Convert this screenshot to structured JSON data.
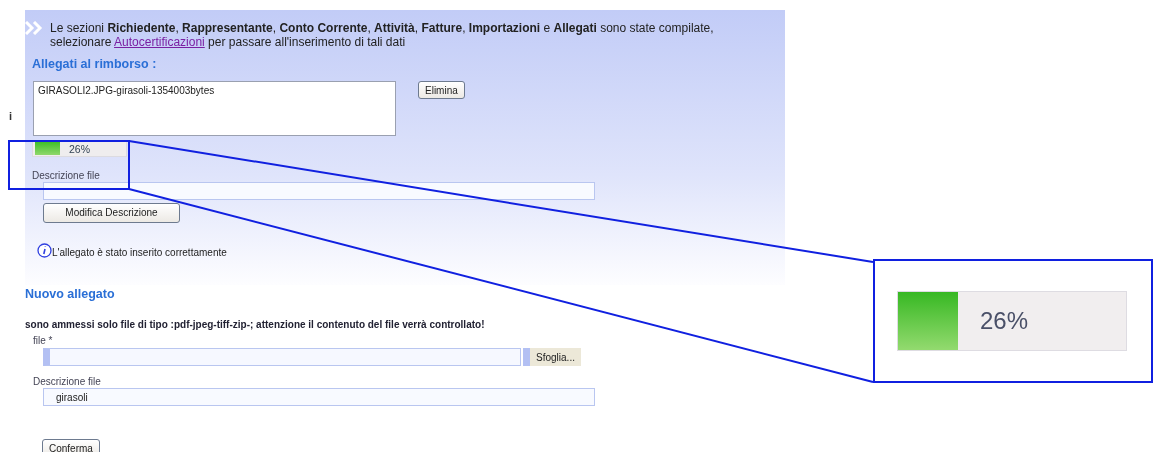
{
  "stray_mark": "i",
  "notice": {
    "before": "Le sezioni **Richiedente**, **Rappresentante**, **Conto Corrente**, **Attività**, **Fatture**, **Importazioni** e **Allegati** sono state compilate, selezionare",
    "link": "Autocertificazioni",
    "after": "per passare all'inserimento di tali dati"
  },
  "attachments": {
    "heading": "Allegati al rimborso :",
    "files": [
      "GIRASOLI2.JPG-girasoli-1354003bytes"
    ],
    "delete_button": "Elimina",
    "upload": {
      "level": 0.26,
      "reading": "26%"
    },
    "description_label": "Descrizione file",
    "edit_button": "Modifica Descrizione",
    "message": "L'allegato è stato inserito correttamente"
  },
  "new_attachment": {
    "heading": "Nuovo allegato",
    "rules": "sono ammessi solo file di tipo :pdf-jpeg-tiff-zip-; attenzione il contenuto del file verrà controllato!",
    "file_label": "file *",
    "browse_button": "Sfoglia...",
    "description_label": "Descrizione file",
    "description_value": "girasoli",
    "confirm_button": "Conferma"
  },
  "zoom_callout": {
    "level": 0.26,
    "reading": "26%"
  }
}
